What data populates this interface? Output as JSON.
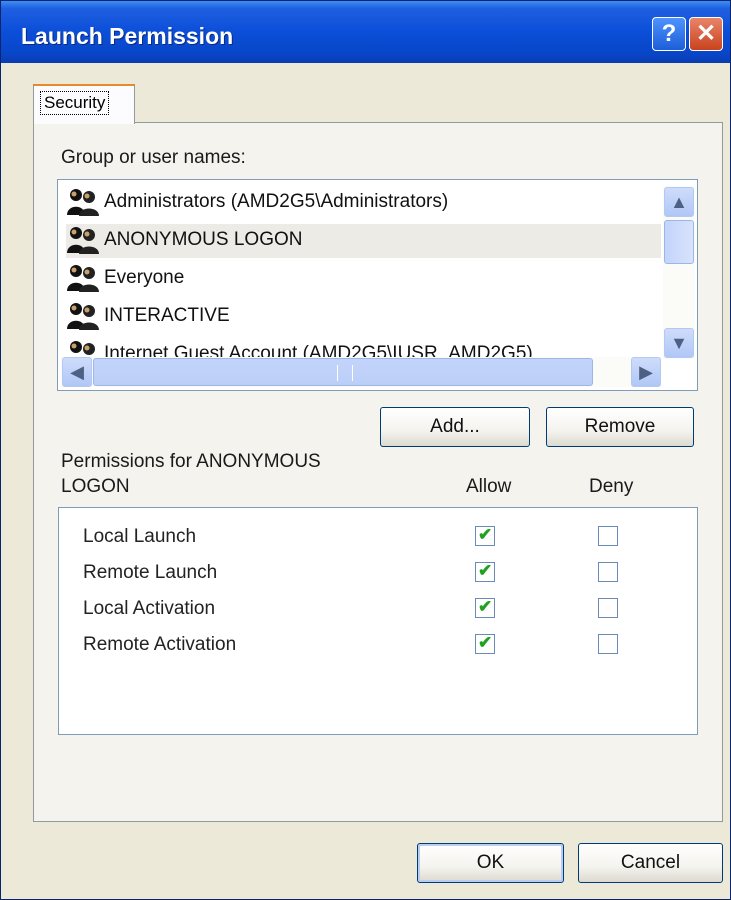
{
  "window": {
    "title": "Launch Permission"
  },
  "tabs": [
    {
      "label": "Security"
    }
  ],
  "group_label": "Group or user names:",
  "users": [
    {
      "name": "Administrators (AMD2G5\\Administrators)",
      "selected": false
    },
    {
      "name": "ANONYMOUS LOGON",
      "selected": true
    },
    {
      "name": "Everyone",
      "selected": false
    },
    {
      "name": "INTERACTIVE",
      "selected": false
    },
    {
      "name": "Internet Guest Account (AMD2G5\\IUSR_AMD2G5)",
      "selected": false
    }
  ],
  "buttons": {
    "add": "Add...",
    "remove": "Remove",
    "ok": "OK",
    "cancel": "Cancel"
  },
  "permissions_label": {
    "line1": "Permissions for ANONYMOUS",
    "line2": "LOGON"
  },
  "columns": {
    "allow": "Allow",
    "deny": "Deny"
  },
  "permissions": [
    {
      "name": "Local Launch",
      "allow": true,
      "deny": false
    },
    {
      "name": "Remote Launch",
      "allow": true,
      "deny": false
    },
    {
      "name": "Local Activation",
      "allow": true,
      "deny": false
    },
    {
      "name": "Remote Activation",
      "allow": true,
      "deny": false
    }
  ],
  "colors": {
    "titlebar": "#0b4ed8",
    "close": "#c9431d",
    "check": "#21a121"
  }
}
